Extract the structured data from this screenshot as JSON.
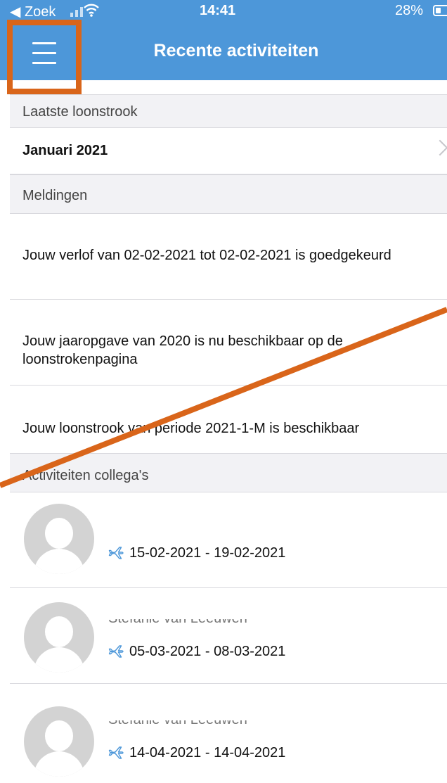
{
  "status_bar": {
    "back_label": "◀ Zoek",
    "time": "14:41",
    "battery": "28%"
  },
  "header": {
    "title": "Recente activiteiten",
    "menu_icon": "hamburger-menu-icon"
  },
  "sections": {
    "payslip_header": "Laatste loonstrook",
    "payslip_value": "Januari 2021",
    "notifications_header": "Meldingen",
    "notifications": [
      "Jouw verlof van 02-02-2021 tot 02-02-2021 is goedgekeurd",
      "Jouw jaaropgave van 2020 is nu beschikbaar op de loonstrokenpagina",
      "Jouw loonstrook van periode 2021-1-M is beschikbaar"
    ],
    "colleagues_header": "Activiteiten collega's",
    "colleagues": [
      {
        "name": "",
        "period": "15-02-2021 - 19-02-2021"
      },
      {
        "name": "Stefanie van Leeuwen",
        "period": "05-03-2021 - 08-03-2021"
      },
      {
        "name": "Stefanie van Leeuwen",
        "period": "14-04-2021 - 14-04-2021"
      }
    ]
  },
  "colors": {
    "header_bg": "#4d97d9",
    "highlight": "#d9651a",
    "icon_accent": "#4d97d9"
  }
}
